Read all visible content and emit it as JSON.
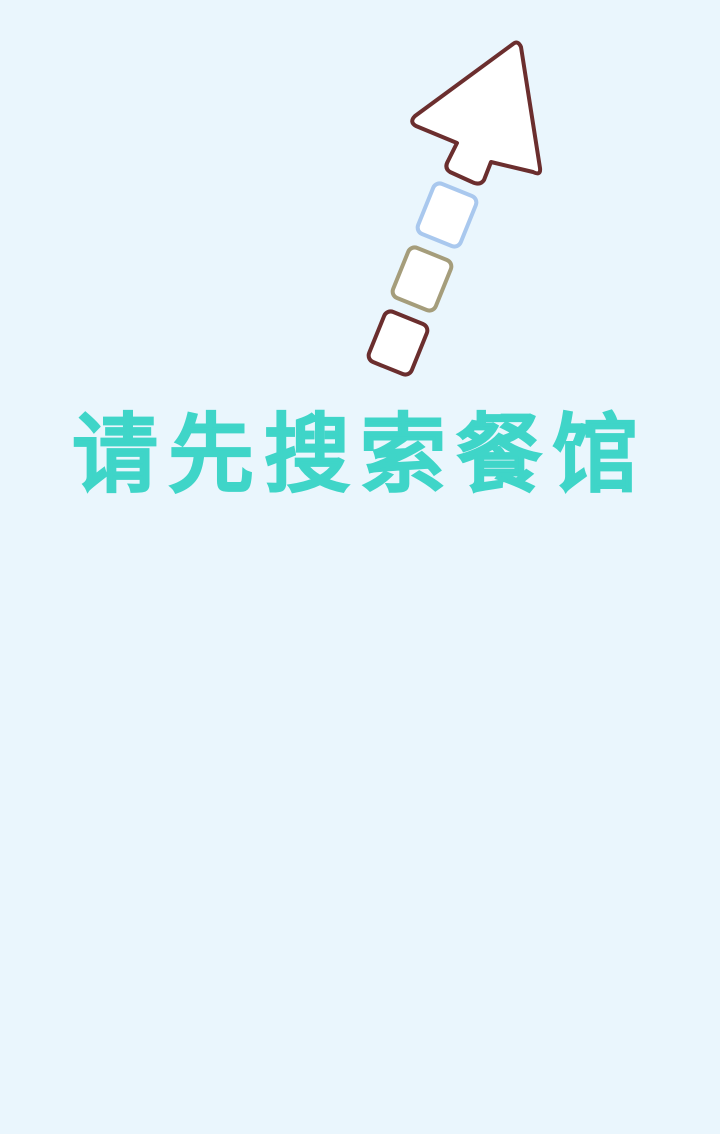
{
  "empty_state": {
    "message": "请先搜索餐馆",
    "icon": "arrow-up-right-icon"
  },
  "colors": {
    "background": "#eaf6fd",
    "message_text": "#3fd5c8",
    "arrow_outline": "#6b2e2e",
    "block_blue": "#a9c8ee",
    "block_olive": "#a59d7b",
    "block_brown": "#6b2e2e"
  }
}
